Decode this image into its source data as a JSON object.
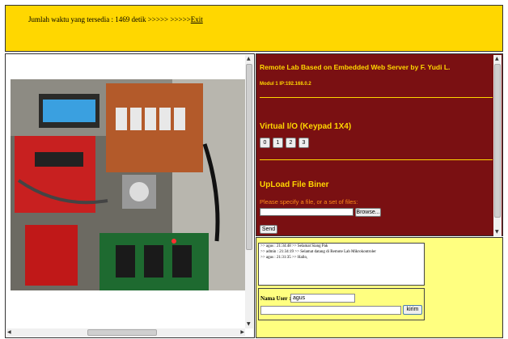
{
  "top": {
    "time_prefix": "Jumlah waktu yang tersedia : 1469 detik >>>>> >>>>>",
    "exit_link": "Exit"
  },
  "left_panel": {
    "photo_alt": "embedded-web-server-board-photo"
  },
  "right_panel": {
    "title": "Remote Lab Based on Embedded Web Server by F. Yudi L.",
    "module": "Modul 1 IP:192.168.0.2",
    "virtual_io_heading": "Virtual I/O (Keypad 1X4)",
    "keys": [
      "0",
      "1",
      "2",
      "3"
    ],
    "upload_heading": "UpLoad File Biner",
    "upload_prompt": "Please specify a file, or a set of files:",
    "browse_label": "Browse...",
    "send_label": "Send"
  },
  "chat": {
    "messages": [
      ">> agus : 21:34:48 >> Selamat Siang Pak",
      ">> admin : 21:34:19 >> Selamat datang di Remote Lab Mikrokontroler",
      ">> agus : 21:31:35 >> Hallo,"
    ],
    "user_label": "Nama User :",
    "user_value": "agus",
    "send_label": "kirim"
  },
  "colors": {
    "top_bg": "#FFD700",
    "panel_bg": "#7A1012",
    "panel_text": "#FFD700",
    "chat_bg": "#FFFF80"
  }
}
